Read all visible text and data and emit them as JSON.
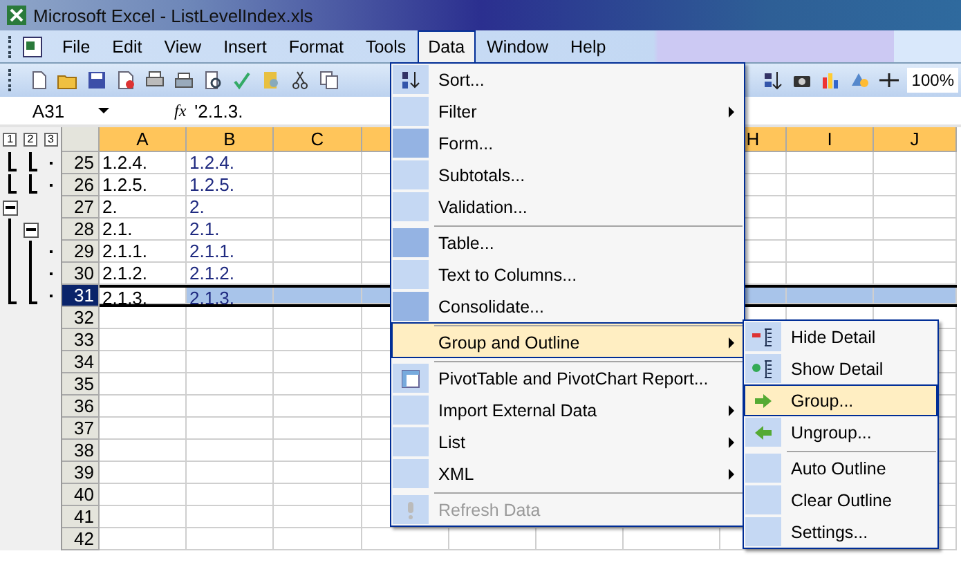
{
  "window": {
    "title": "Microsoft Excel - ListLevelIndex.xls"
  },
  "menu_bar": [
    {
      "label": "File",
      "selected": false
    },
    {
      "label": "Edit",
      "selected": false
    },
    {
      "label": "View",
      "selected": false
    },
    {
      "label": "Insert",
      "selected": false
    },
    {
      "label": "Format",
      "selected": false
    },
    {
      "label": "Tools",
      "selected": false
    },
    {
      "label": "Data",
      "selected": true
    },
    {
      "label": "Window",
      "selected": false
    },
    {
      "label": "Help",
      "selected": false
    }
  ],
  "toolbar": {
    "zoom": "100%"
  },
  "formula_bar": {
    "name_box": "A31",
    "fx": "fx",
    "value": "'2.1.3."
  },
  "outline_levels": [
    "1",
    "2",
    "3"
  ],
  "columns": [
    {
      "label": "A",
      "selected": true
    },
    {
      "label": "B",
      "selected": true
    },
    {
      "label": "C",
      "selected": true
    },
    {
      "label": "H",
      "selected": true
    },
    {
      "label": "I",
      "selected": true
    },
    {
      "label": "J",
      "selected": true
    }
  ],
  "rows": [
    {
      "number": "25",
      "a": "1.2.4.",
      "b": "1.2.4.",
      "kind": "detail",
      "group_end": true,
      "selected": false
    },
    {
      "number": "26",
      "a": "1.2.5.",
      "b": "1.2.5.",
      "kind": "detail",
      "group_end": true,
      "selected": false
    },
    {
      "number": "27",
      "a": "2.",
      "b": "2.",
      "kind": "collapse1",
      "selected": false
    },
    {
      "number": "28",
      "a": "2.1.",
      "b": "2.1.",
      "kind": "collapse2",
      "group_end": false,
      "selected": false
    },
    {
      "number": "29",
      "a": "2.1.1.",
      "b": "2.1.1.",
      "kind": "detail",
      "group_end": false,
      "selected": false
    },
    {
      "number": "30",
      "a": "2.1.2.",
      "b": "2.1.2.",
      "kind": "detail",
      "group_end": false,
      "selected": false
    },
    {
      "number": "31",
      "a": "2.1.3.",
      "b": "2.1.3.",
      "kind": "detail",
      "group_end": true,
      "selected": true
    },
    {
      "number": "32"
    },
    {
      "number": "33"
    },
    {
      "number": "34"
    },
    {
      "number": "35"
    },
    {
      "number": "36"
    },
    {
      "number": "37"
    },
    {
      "number": "38"
    },
    {
      "number": "39"
    },
    {
      "number": "40"
    },
    {
      "number": "41"
    },
    {
      "number": "42"
    }
  ],
  "data_menu": [
    {
      "label": "Sort...",
      "kind": "sort",
      "submenu": false,
      "selected": false,
      "disabled": false,
      "separator_before": false,
      "rarely_used": false
    },
    {
      "label": "Filter",
      "kind": "plain",
      "submenu": true,
      "selected": false,
      "disabled": false,
      "separator_before": false,
      "rarely_used": false
    },
    {
      "label": "Form...",
      "kind": "plain",
      "submenu": false,
      "selected": false,
      "disabled": false,
      "separator_before": false,
      "rarely_used": true
    },
    {
      "label": "Subtotals...",
      "kind": "plain",
      "submenu": false,
      "selected": false,
      "disabled": false,
      "separator_before": false,
      "rarely_used": false
    },
    {
      "label": "Validation...",
      "kind": "plain",
      "submenu": false,
      "selected": false,
      "disabled": false,
      "separator_before": false,
      "rarely_used": false
    },
    {
      "label": "Table...",
      "kind": "plain",
      "submenu": false,
      "selected": false,
      "disabled": false,
      "separator_before": true,
      "rarely_used": true
    },
    {
      "label": "Text to Columns...",
      "kind": "plain",
      "submenu": false,
      "selected": false,
      "disabled": false,
      "separator_before": false,
      "rarely_used": false
    },
    {
      "label": "Consolidate...",
      "kind": "plain",
      "submenu": false,
      "selected": false,
      "disabled": false,
      "separator_before": false,
      "rarely_used": true
    },
    {
      "label": "Group and Outline",
      "kind": "plain",
      "submenu": true,
      "selected": true,
      "disabled": false,
      "separator_before": true,
      "rarely_used": false
    },
    {
      "label": "PivotTable and PivotChart Report...",
      "kind": "pivot",
      "submenu": false,
      "selected": false,
      "disabled": false,
      "separator_before": true,
      "rarely_used": false
    },
    {
      "label": "Import External Data",
      "kind": "plain",
      "submenu": true,
      "selected": false,
      "disabled": false,
      "separator_before": false,
      "rarely_used": false
    },
    {
      "label": "List",
      "kind": "plain",
      "submenu": true,
      "selected": false,
      "disabled": false,
      "separator_before": false,
      "rarely_used": false
    },
    {
      "label": "XML",
      "kind": "plain",
      "submenu": true,
      "selected": false,
      "disabled": false,
      "separator_before": false,
      "rarely_used": false
    },
    {
      "label": "Refresh Data",
      "kind": "refresh",
      "submenu": false,
      "selected": false,
      "disabled": true,
      "separator_before": true,
      "rarely_used": false
    }
  ],
  "group_submenu": [
    {
      "label": "Hide Detail",
      "kind": "hide",
      "selected": false,
      "separator_before": false
    },
    {
      "label": "Show Detail",
      "kind": "show",
      "selected": false,
      "separator_before": false
    },
    {
      "label": "Group...",
      "kind": "group",
      "selected": true,
      "separator_before": false
    },
    {
      "label": "Ungroup...",
      "kind": "ungroup",
      "selected": false,
      "separator_before": false
    },
    {
      "label": "Auto Outline",
      "kind": "plain",
      "selected": false,
      "separator_before": true
    },
    {
      "label": "Clear Outline",
      "kind": "plain",
      "selected": false,
      "separator_before": false
    },
    {
      "label": "Settings...",
      "kind": "plain",
      "selected": false,
      "separator_before": false
    }
  ]
}
